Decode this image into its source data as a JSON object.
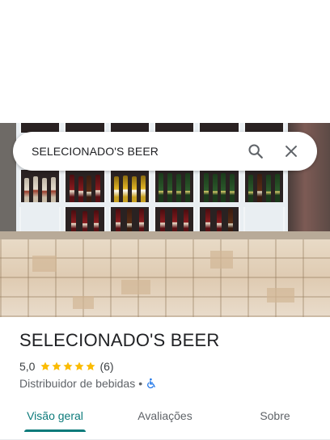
{
  "search": {
    "query": "SELECIONADO'S BEER"
  },
  "place": {
    "name": "SELECIONADO'S BEER",
    "rating": "5,0",
    "stars_filled": 5,
    "review_count": "(6)",
    "category": "Distribuidor de bebidas",
    "separator": "•",
    "accessibility_icon": "wheelchair-accessible-icon"
  },
  "tabs": [
    {
      "label": "Visão geral",
      "active": true
    },
    {
      "label": "Avaliações",
      "active": false
    },
    {
      "label": "Sobre",
      "active": false
    }
  ],
  "colors": {
    "accent": "#0b7a7a",
    "star": "#fbbc04",
    "accessibility": "#1a73e8"
  }
}
